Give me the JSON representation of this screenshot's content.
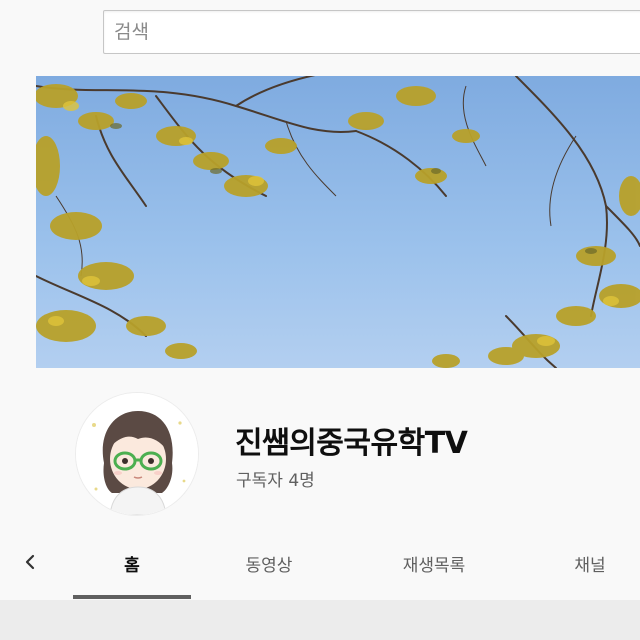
{
  "search": {
    "placeholder": "검색",
    "value": ""
  },
  "banner": {
    "description_icon": "sky-tree-banner"
  },
  "channel": {
    "name": "진쌤의중국유학TV",
    "subscribers": "구독자 4명",
    "avatar_icon": "cartoon-girl-avatar"
  },
  "tabs": {
    "prev_icon": "chevron-left-icon",
    "items": [
      {
        "label": "홈",
        "active": true
      },
      {
        "label": "동영상",
        "active": false
      },
      {
        "label": "재생목록",
        "active": false
      },
      {
        "label": "채널",
        "active": false
      }
    ]
  },
  "colors": {
    "sky": "#8fb7e6",
    "leaf": "#b8a12a",
    "text_primary": "#0f0f0f",
    "text_secondary": "#606060",
    "glasses_green": "#4caf50"
  }
}
